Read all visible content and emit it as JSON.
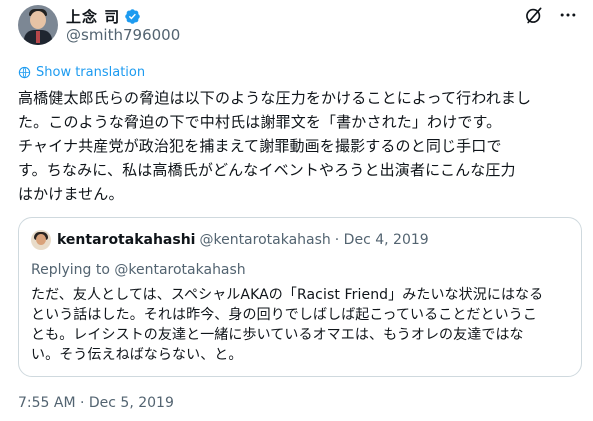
{
  "author": {
    "display_name": "上念 司",
    "handle": "@smith796000"
  },
  "show_translation_label": "Show translation",
  "tweet": {
    "lines": [
      "高橋健太郎氏らの脅迫は以下のような圧力をかけることによって行われまし",
      "た。このような脅迫の下で中村氏は謝罪文を「書かされた」わけです。",
      "チャイナ共産党が政治犯を捕まえて謝罪動画を撮影するのと同じ手口で",
      "す。ちなみに、私は高橋氏がどんなイベントやろうと出演者にこんな圧力",
      "はかけません。"
    ],
    "timestamp": "7:55 AM · Dec 5, 2019"
  },
  "quote": {
    "name": "kentarotakahashi",
    "handle": "@kentarotakahash",
    "date": "· Dec 4, 2019",
    "replying_to": "Replying to @kentarotakahash",
    "lines": [
      "ただ、友人としては、スペシャルAKAの「Racist Friend」みたいな状況にはなる",
      "という話はした。それは昨今、身の回りでしばしば起こっていることだというこ",
      "とも。レイシストの友達と一緒に歩いているオマエは、もうオレの友達ではな",
      "い。そう伝えねばならない、と。"
    ]
  },
  "colors": {
    "accent": "#1d9bf0",
    "secondary_text": "#536471",
    "border": "#cfd9de"
  },
  "icons": [
    "verified-badge-icon",
    "grok-icon",
    "more-icon",
    "translate-icon"
  ]
}
